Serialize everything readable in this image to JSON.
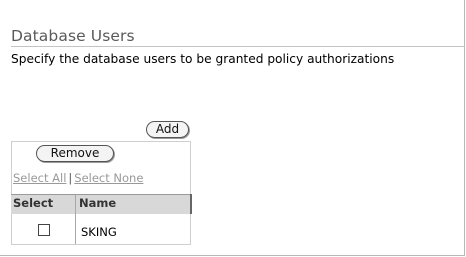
{
  "section": {
    "title": "Database Users",
    "description": "Specify the database users to be granted policy authorizations"
  },
  "buttons": {
    "add_label": "Add",
    "remove_label": "Remove"
  },
  "selection": {
    "select_all": "Select All",
    "separator": "|",
    "select_none": "Select None"
  },
  "table": {
    "headers": [
      "Select",
      "Name"
    ],
    "rows": [
      {
        "checked": false,
        "name": "SKING"
      }
    ]
  }
}
